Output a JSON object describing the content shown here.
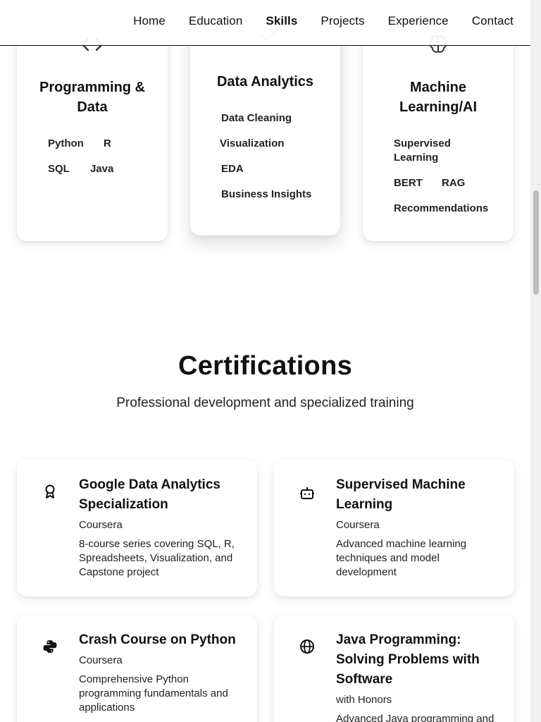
{
  "nav": {
    "items": [
      {
        "label": "Home"
      },
      {
        "label": "Education"
      },
      {
        "label": "Skills"
      },
      {
        "label": "Projects"
      },
      {
        "label": "Experience"
      },
      {
        "label": "Contact"
      }
    ],
    "active": "Skills"
  },
  "skills": {
    "cards": [
      {
        "title_line1": "Programming &",
        "title_line2": "Data",
        "icon": "code-icon",
        "tags": [
          "Python",
          "R",
          "SQL",
          "Java"
        ]
      },
      {
        "title": "Data Analytics",
        "icon": "trend-icon",
        "tags": [
          "Data Cleaning",
          "Visualization",
          "EDA",
          "Business Insights"
        ]
      },
      {
        "title_line1": "Machine",
        "title_line2": "Learning/AI",
        "icon": "brain-icon",
        "tags": [
          "Supervised",
          "Learning",
          "BERT",
          "RAG",
          "Recommendations"
        ]
      }
    ]
  },
  "certifications": {
    "title": "Certifications",
    "subtitle": "Professional development and specialized training",
    "items": [
      {
        "title_line1": "Google Data Analytics",
        "title_line2": "Specialization",
        "org": "Coursera",
        "desc_lines": [
          "8-course series covering SQL, R,",
          "Spreadsheets, Visualization, and",
          "Capstone project"
        ],
        "icon": "award-icon"
      },
      {
        "title_line1": "Supervised Machine",
        "title_line2": "Learning",
        "org": "Coursera",
        "desc_lines": [
          "Advanced machine learning",
          "techniques and model",
          "development"
        ],
        "icon": "robot-icon"
      },
      {
        "title_line1": "Crash Course on Python",
        "org": "Coursera",
        "desc_lines": [
          "Comprehensive Python",
          "programming fundamentals and",
          "applications"
        ],
        "icon": "python-icon"
      },
      {
        "title_line1": "Java Programming:",
        "title_line2": "Solving Problems with",
        "title_line3": "Software",
        "org": "with Honors",
        "desc_lines": [
          "Advanced Java programming and"
        ],
        "icon": "globe-icon"
      }
    ]
  },
  "colors": {
    "text": "#111111",
    "background": "#ffffff",
    "accent": "#111111"
  }
}
